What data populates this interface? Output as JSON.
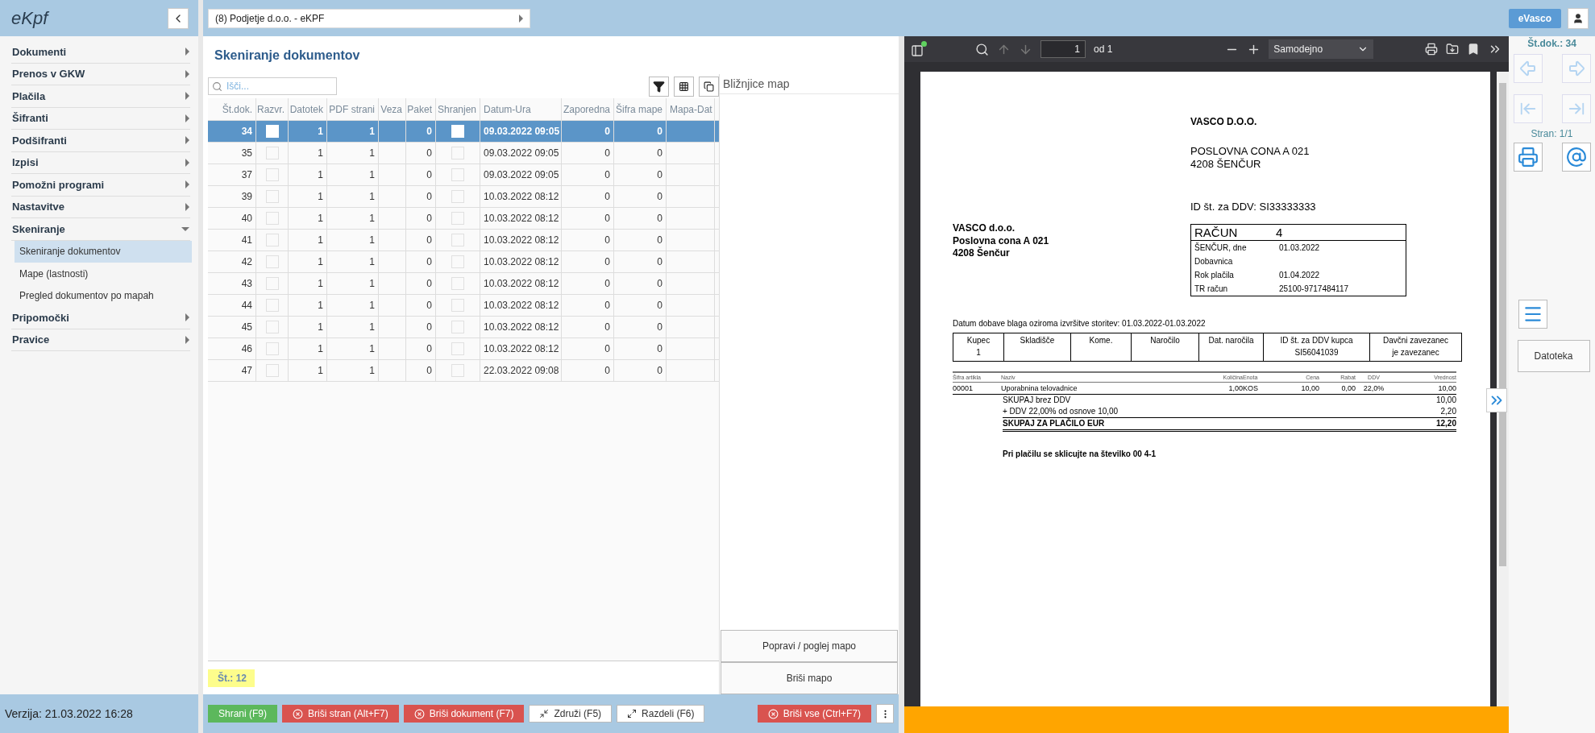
{
  "app": {
    "logo": "eKpf",
    "company": "(8) Podjetje d.o.o. - eKPF",
    "user": "eVasco"
  },
  "sidebar": {
    "items": [
      {
        "label": "Dokumenti",
        "expanded": false
      },
      {
        "label": "Prenos v GKW",
        "expanded": false
      },
      {
        "label": "Plačila",
        "expanded": false
      },
      {
        "label": "Šifranti",
        "expanded": false
      },
      {
        "label": "Podšifranti",
        "expanded": false
      },
      {
        "label": "Izpisi",
        "expanded": false
      },
      {
        "label": "Pomožni programi",
        "expanded": false
      },
      {
        "label": "Nastavitve",
        "expanded": false
      },
      {
        "label": "Skeniranje",
        "expanded": true,
        "children": [
          {
            "label": "Skeniranje dokumentov",
            "selected": true
          },
          {
            "label": "Mape (lastnosti)",
            "selected": false
          },
          {
            "label": "Pregled dokumentov po mapah",
            "selected": false
          }
        ]
      },
      {
        "label": "Pripomočki",
        "expanded": false
      },
      {
        "label": "Pravice",
        "expanded": false
      }
    ],
    "version": "Verzija: 21.03.2022 16:28"
  },
  "page": {
    "title": "Skeniranje dokumentov",
    "search": {
      "placeholder": "Išči..."
    }
  },
  "table": {
    "columns": [
      "Št.dok.",
      "Razvr.",
      "Datotek",
      "PDF strani",
      "Veza",
      "Paket",
      "Shranjen",
      "Datum-Ura",
      "Zaporedna",
      "Šifra mape",
      "Mapa-Dat"
    ],
    "rows": [
      {
        "selected": true,
        "st_dok": "34",
        "razvr": false,
        "datotek": "1",
        "pdf_strani": "1",
        "paket": "0",
        "shranjen": false,
        "datum_ura": "09.03.2022 09:05",
        "zaporedna": "0",
        "sifra_mape": "0"
      },
      {
        "selected": false,
        "st_dok": "35",
        "razvr": false,
        "datotek": "1",
        "pdf_strani": "1",
        "paket": "0",
        "shranjen": false,
        "datum_ura": "09.03.2022 09:05",
        "zaporedna": "0",
        "sifra_mape": "0"
      },
      {
        "selected": false,
        "st_dok": "37",
        "razvr": false,
        "datotek": "1",
        "pdf_strani": "1",
        "paket": "0",
        "shranjen": false,
        "datum_ura": "09.03.2022 09:05",
        "zaporedna": "0",
        "sifra_mape": "0"
      },
      {
        "selected": false,
        "st_dok": "39",
        "razvr": false,
        "datotek": "1",
        "pdf_strani": "1",
        "paket": "0",
        "shranjen": false,
        "datum_ura": "10.03.2022 08:12",
        "zaporedna": "0",
        "sifra_mape": "0"
      },
      {
        "selected": false,
        "st_dok": "40",
        "razvr": false,
        "datotek": "1",
        "pdf_strani": "1",
        "paket": "0",
        "shranjen": false,
        "datum_ura": "10.03.2022 08:12",
        "zaporedna": "0",
        "sifra_mape": "0"
      },
      {
        "selected": false,
        "st_dok": "41",
        "razvr": false,
        "datotek": "1",
        "pdf_strani": "1",
        "paket": "0",
        "shranjen": false,
        "datum_ura": "10.03.2022 08:12",
        "zaporedna": "0",
        "sifra_mape": "0"
      },
      {
        "selected": false,
        "st_dok": "42",
        "razvr": false,
        "datotek": "1",
        "pdf_strani": "1",
        "paket": "0",
        "shranjen": false,
        "datum_ura": "10.03.2022 08:12",
        "zaporedna": "0",
        "sifra_mape": "0"
      },
      {
        "selected": false,
        "st_dok": "43",
        "razvr": false,
        "datotek": "1",
        "pdf_strani": "1",
        "paket": "0",
        "shranjen": false,
        "datum_ura": "10.03.2022 08:12",
        "zaporedna": "0",
        "sifra_mape": "0"
      },
      {
        "selected": false,
        "st_dok": "44",
        "razvr": false,
        "datotek": "1",
        "pdf_strani": "1",
        "paket": "0",
        "shranjen": false,
        "datum_ura": "10.03.2022 08:12",
        "zaporedna": "0",
        "sifra_mape": "0"
      },
      {
        "selected": false,
        "st_dok": "45",
        "razvr": false,
        "datotek": "1",
        "pdf_strani": "1",
        "paket": "0",
        "shranjen": false,
        "datum_ura": "10.03.2022 08:12",
        "zaporedna": "0",
        "sifra_mape": "0"
      },
      {
        "selected": false,
        "st_dok": "46",
        "razvr": false,
        "datotek": "1",
        "pdf_strani": "1",
        "paket": "0",
        "shranjen": false,
        "datum_ura": "10.03.2022 08:12",
        "zaporedna": "0",
        "sifra_mape": "0"
      },
      {
        "selected": false,
        "st_dok": "47",
        "razvr": false,
        "datotek": "1",
        "pdf_strani": "1",
        "paket": "0",
        "shranjen": false,
        "datum_ura": "22.03.2022 09:08",
        "zaporedna": "0",
        "sifra_mape": "0"
      }
    ],
    "count": "Št.: 12"
  },
  "shortcuts": {
    "title": "Bližnjice map",
    "buttons": [
      "Popravi / poglej mapo",
      "Briši mapo"
    ]
  },
  "actions": [
    {
      "label": "Shrani (F9)",
      "kind": "success"
    },
    {
      "label": "Briši stran (Alt+F7)",
      "kind": "danger"
    },
    {
      "label": "Briši dokument (F7)",
      "kind": "danger"
    },
    {
      "label": "Združi (F5)",
      "kind": "default"
    },
    {
      "label": "Razdeli (F6)",
      "kind": "default"
    },
    {
      "label": "Briši vse (Ctrl+F7)",
      "kind": "danger"
    }
  ],
  "pdf": {
    "page": "1",
    "page_total": "od 1",
    "zoom": "Samodejno",
    "document": {
      "seller_name": "VASCO D.O.O.",
      "seller_address": [
        "POSLOVNA CONA A 021",
        "4208 ŠENČUR"
      ],
      "seller_vat": "ID št. za DDV: SI33333333",
      "recipient": [
        "VASCO d.o.o.",
        "Poslovna cona A 021",
        "4208 Šenčur"
      ],
      "invoice": {
        "title": "RAČUN",
        "number": "4",
        "fields": [
          {
            "label": "ŠENČUR, dne",
            "value": "01.03.2022"
          },
          {
            "label": "Dobavnica"
          },
          {
            "label": "Rok plačila",
            "value": "01.04.2022"
          },
          {
            "label": "TR račun",
            "value": "25100-9717484117"
          }
        ]
      },
      "delivery": "Datum dobave blaga oziroma izvršitve storitev: 01.03.2022-01.03.2022",
      "info": [
        {
          "label": "Kupec",
          "value": "1"
        },
        {
          "label": "Skladišče"
        },
        {
          "label": "Kome."
        },
        {
          "label": "Naročilo"
        },
        {
          "label": "Dat. naročila"
        },
        {
          "label": "ID št. za DDV kupca",
          "value": "SI56041039"
        },
        {
          "label": "Davčni zavezanec",
          "value": "je zavezanec"
        }
      ],
      "item_columns": [
        "Šifra artikla",
        "Naziv",
        "Količina",
        "Enota",
        "Cena",
        "Rabat",
        "DDV",
        "Vrednost"
      ],
      "items": [
        [
          "00001",
          "Uporabnina telovadnice",
          "1,00",
          "KOS",
          "10,00",
          "0,00",
          "22,0%",
          "10,00"
        ]
      ],
      "totals": [
        {
          "label": "SKUPAJ brez DDV",
          "value": "10,00",
          "kind": "sum"
        },
        {
          "label": "+ DDV 22,00% od osnove 10,00",
          "value": "2,20",
          "kind": "sum"
        },
        {
          "label": "SKUPAJ ZA PLAČILO EUR",
          "value": "12,20",
          "kind": "grand"
        }
      ],
      "note": "Pri plačilu se sklicujte na številko 00 4-1"
    }
  },
  "side": {
    "doc_number": "Št.dok.: 34",
    "page_info": "Stran: 1/1",
    "file_button": "Datoteka"
  }
}
